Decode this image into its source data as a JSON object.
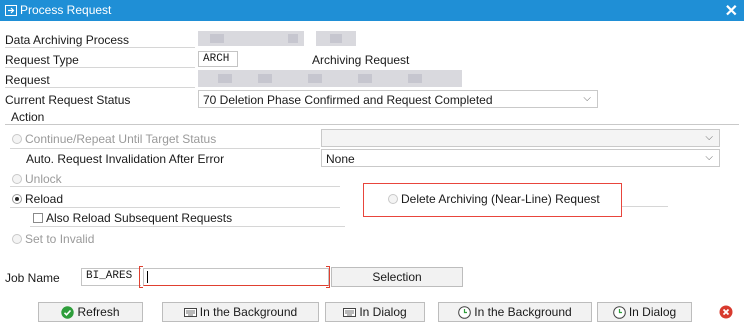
{
  "window": {
    "title": "Process Request",
    "close_label": "✕"
  },
  "fields": {
    "data_archiving_process": {
      "label": "Data Archiving Process"
    },
    "request_type": {
      "label": "Request Type",
      "code": "ARCH",
      "description": "Archiving Request"
    },
    "request": {
      "label": "Request"
    },
    "current_request_status": {
      "label": "Current Request Status",
      "value": "70 Deletion Phase Confirmed and Request Completed"
    }
  },
  "action": {
    "group_label": "Action",
    "continue_label": "Continue/Repeat Until Target Status",
    "auto_invalidation_label": "Auto. Request Invalidation After Error",
    "auto_invalidation_value": "None",
    "unlock_label": "Unlock",
    "reload_label": "Reload",
    "reload_selected": true,
    "also_reload_label": "Also Reload Subsequent Requests",
    "delete_label": "Delete Archiving (Near-Line) Request",
    "set_invalid_label": "Set to Invalid"
  },
  "job": {
    "label": "Job Name",
    "value": "BI_ARES",
    "selection_button": "Selection"
  },
  "footer": {
    "refresh": "Refresh",
    "in_background_1": "In the Background",
    "in_dialog_1": "In Dialog",
    "in_background_2": "In the Background",
    "in_dialog_2": "In Dialog"
  },
  "colors": {
    "titlebar": "#1f8fd6",
    "highlight_box": "#e8453c",
    "refresh_icon": "#2e9e3b",
    "cancel_icon": "#d83a2e"
  }
}
